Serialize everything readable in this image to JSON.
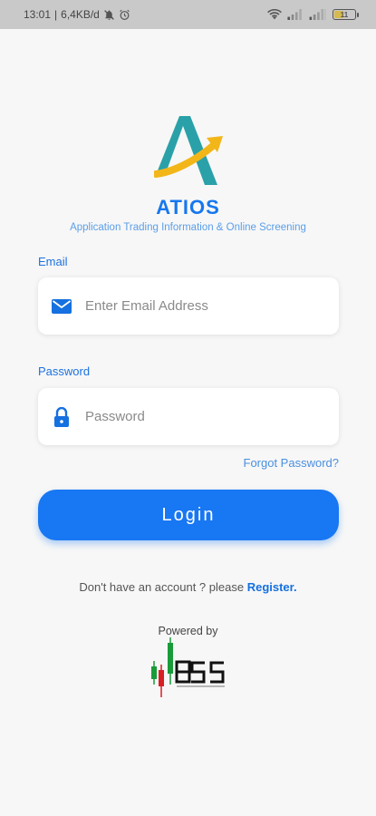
{
  "status_bar": {
    "time": "13:01",
    "network_speed": "6,4KB/d",
    "battery": "11"
  },
  "app": {
    "name": "ATIOS",
    "tagline": "Application Trading Information & Online Screening",
    "brand_color": "#1677ee",
    "logo_teal": "#2aa1a8",
    "logo_gold": "#f2b619"
  },
  "form": {
    "email_label": "Email",
    "email_placeholder": "Enter Email Address",
    "email_value": "",
    "email_icon": "mail-icon",
    "password_label": "Password",
    "password_placeholder": "Password",
    "password_value": "",
    "password_icon": "lock-icon",
    "forgot_password": "Forgot Password?",
    "login_label": "Login"
  },
  "register": {
    "prompt": "Don't have an account ? please ",
    "link": "Register."
  },
  "footer": {
    "powered_by": "Powered by",
    "sponsor_logo": "bss-logo"
  }
}
